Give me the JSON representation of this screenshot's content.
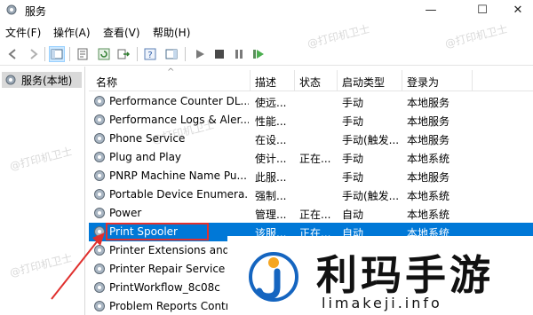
{
  "window": {
    "title": "服务",
    "icon": "gear-icon"
  },
  "menu": [
    "文件(F)",
    "操作(A)",
    "查看(V)",
    "帮助(H)"
  ],
  "tree": {
    "item": "服务(本地)"
  },
  "columns": {
    "name": "名称",
    "desc": "描述",
    "status": "状态",
    "startup": "启动类型",
    "logon": "登录为"
  },
  "services": [
    {
      "name": "Performance Counter DL...",
      "desc": "使远...",
      "status": "",
      "startup": "手动",
      "logon": "本地服务"
    },
    {
      "name": "Performance Logs & Aler...",
      "desc": "性能...",
      "status": "",
      "startup": "手动",
      "logon": "本地服务"
    },
    {
      "name": "Phone Service",
      "desc": "在设...",
      "status": "",
      "startup": "手动(触发...",
      "logon": "本地服务"
    },
    {
      "name": "Plug and Play",
      "desc": "使计...",
      "status": "正在...",
      "startup": "手动",
      "logon": "本地系统"
    },
    {
      "name": "PNRP Machine Name Pu...",
      "desc": "此服...",
      "status": "",
      "startup": "手动",
      "logon": "本地服务"
    },
    {
      "name": "Portable Device Enumera...",
      "desc": "强制...",
      "status": "",
      "startup": "手动(触发...",
      "logon": "本地系统"
    },
    {
      "name": "Power",
      "desc": "管理...",
      "status": "正在...",
      "startup": "自动",
      "logon": "本地系统"
    },
    {
      "name": "Print Spooler",
      "desc": "该服...",
      "status": "正在...",
      "startup": "自动",
      "logon": "本地系统"
    },
    {
      "name": "Printer Extensions and ...",
      "desc": "",
      "status": "",
      "startup": "",
      "logon": ""
    },
    {
      "name": "Printer Repair Service",
      "desc": "",
      "status": "",
      "startup": "",
      "logon": ""
    },
    {
      "name": "PrintWorkflow_8c08c",
      "desc": "",
      "status": "",
      "startup": "",
      "logon": ""
    },
    {
      "name": "Problem Reports Contr...",
      "desc": "",
      "status": "",
      "startup": "",
      "logon": ""
    }
  ],
  "selected_index": 7,
  "watermark": {
    "title": "利玛手游",
    "url": "limakeji.info",
    "faint": "@打印机卫士"
  },
  "colors": {
    "selection": "#0078d7",
    "highlight": "#e0302e",
    "accent": "#1565c0"
  }
}
